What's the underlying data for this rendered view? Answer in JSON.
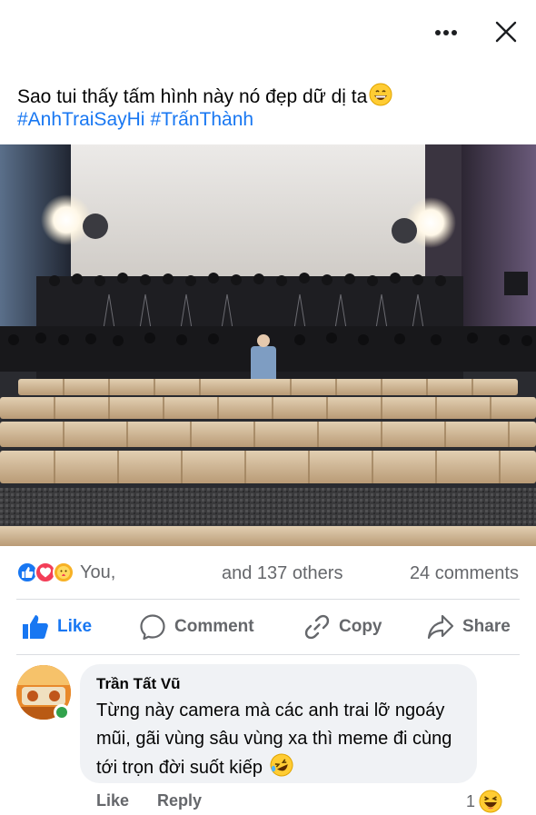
{
  "header": {
    "more_icon": "more-horizontal-icon",
    "close_icon": "close-icon"
  },
  "post": {
    "text": "Sao tui thấy tấm hình này nó đẹp dữ dị ta",
    "hashtags": [
      "#AnhTraiSayHi",
      "#TrấnThành"
    ]
  },
  "stats": {
    "reactions": [
      "like",
      "love",
      "care"
    ],
    "you_label": "You,",
    "others_label": "and 137 others",
    "comments_label": "24 comments"
  },
  "actions": {
    "like": "Like",
    "comment": "Comment",
    "copy": "Copy",
    "share": "Share"
  },
  "comment": {
    "author": "Trần Tất Vũ",
    "text": "Từng này camera mà các anh trai lỡ ngoáy mũi, gãi vùng sâu vùng xa thì meme đi cùng tới trọn đời suốt kiếp",
    "like_label": "Like",
    "reply_label": "Reply",
    "reaction_count": "1"
  },
  "colors": {
    "accent": "#1877f2",
    "muted": "#65676b",
    "bubble": "#f0f2f5",
    "online": "#31a24c"
  }
}
